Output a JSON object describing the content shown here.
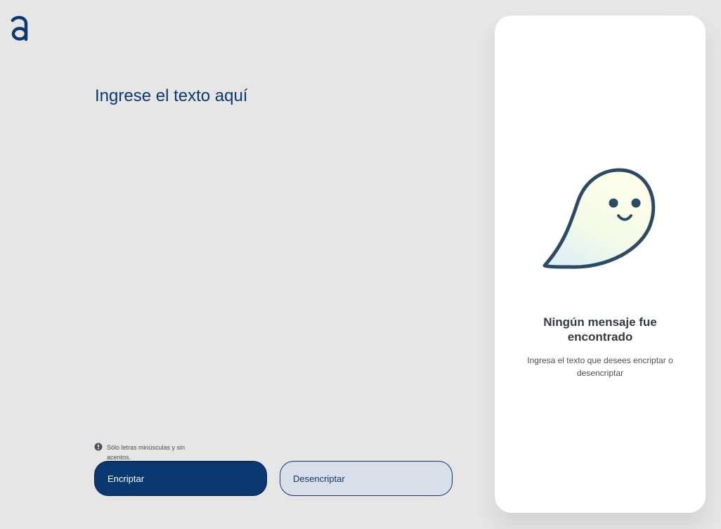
{
  "input": {
    "placeholder": "Ingrese el texto aquí",
    "value": ""
  },
  "hint": {
    "text": "Sólo letras minúsculas y sin acentos.",
    "icon": "exclamation-circle-icon"
  },
  "buttons": {
    "encrypt_label": "Encriptar",
    "decrypt_label": "Desencriptar"
  },
  "output": {
    "title": "Ningún mensaje fue encontrado",
    "description": "Ingresa el texto que desees encriptar o desencriptar",
    "illustration": "ghost-icon"
  },
  "colors": {
    "background": "#e5e5e5",
    "primary": "#0a3871",
    "secondary_bg": "#d8dfe8",
    "card": "#ffffff",
    "heading": "#343a40",
    "text": "#495057"
  }
}
